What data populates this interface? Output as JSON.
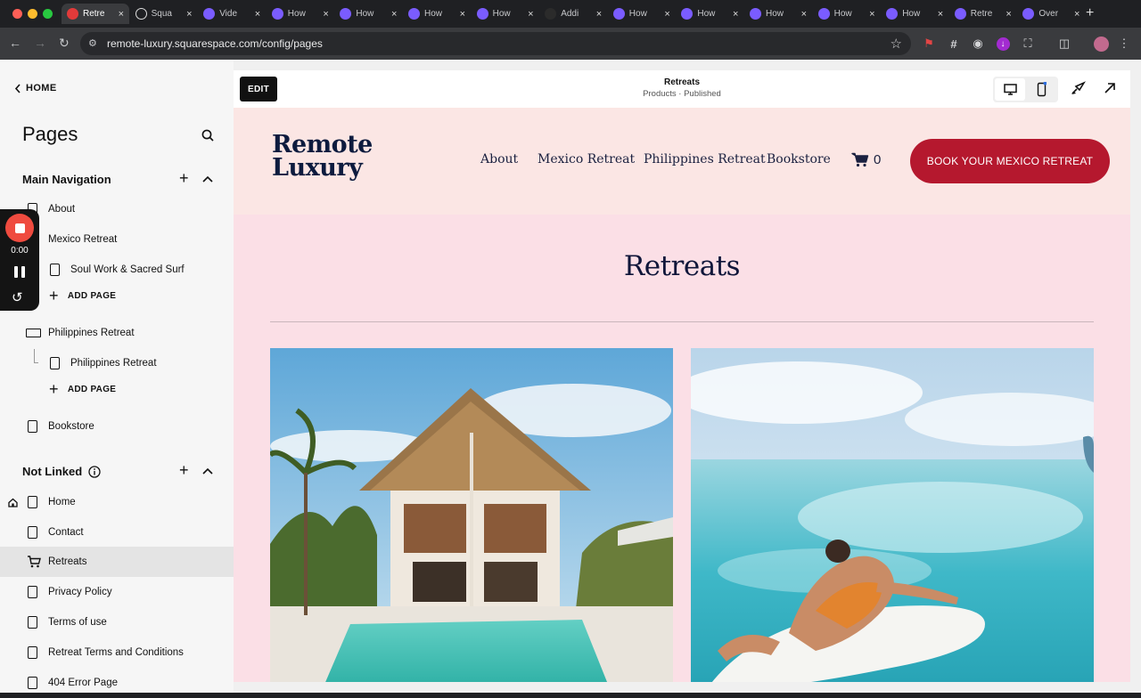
{
  "browser": {
    "tabs": [
      {
        "label": "Retre",
        "active": true,
        "favicon": "squarespace-icon"
      },
      {
        "label": "Squa",
        "favicon": "squarespace-icon"
      },
      {
        "label": "Vide",
        "favicon": "sparkle-icon"
      },
      {
        "label": "How",
        "favicon": "sparkle-icon"
      },
      {
        "label": "How",
        "favicon": "sparkle-icon"
      },
      {
        "label": "How",
        "favicon": "sparkle-icon"
      },
      {
        "label": "How",
        "favicon": "sparkle-icon"
      },
      {
        "label": "Addi",
        "favicon": "dark-icon"
      },
      {
        "label": "How",
        "favicon": "sparkle-icon"
      },
      {
        "label": "How",
        "favicon": "sparkle-icon"
      },
      {
        "label": "How",
        "favicon": "sparkle-icon"
      },
      {
        "label": "How",
        "favicon": "sparkle-icon"
      },
      {
        "label": "How",
        "favicon": "sparkle-icon"
      },
      {
        "label": "Retre",
        "favicon": "sparkle-icon"
      },
      {
        "label": "Over",
        "favicon": "sparkle-icon"
      }
    ],
    "url": "remote-luxury.squarespace.com/config/pages"
  },
  "sidebar": {
    "home_label": "HOME",
    "title": "Pages",
    "main_nav_title": "Main Navigation",
    "not_linked_title": "Not Linked",
    "add_page_label": "ADD PAGE",
    "main_nav_items": {
      "about": "About",
      "mexico": "Mexico Retreat",
      "soul": "Soul Work & Sacred Surf",
      "philippines": "Philippines Retreat",
      "philippines_child": "Philippines Retreat",
      "bookstore": "Bookstore"
    },
    "not_linked_items": {
      "home": "Home",
      "contact": "Contact",
      "retreats": "Retreats",
      "privacy": "Privacy Policy",
      "terms": "Terms of use",
      "retreat_terms": "Retreat Terms and Conditions",
      "error404": "404 Error Page"
    }
  },
  "recorder": {
    "time": "0:00"
  },
  "editor": {
    "edit_label": "EDIT",
    "page_name": "Retreats",
    "page_status": "Products · Published"
  },
  "site": {
    "logo_line1": "Remote",
    "logo_line2": "Luxury",
    "nav": {
      "about": "About",
      "mexico": "Mexico Retreat",
      "philippines": "Philippines Retreat",
      "bookstore": "Bookstore"
    },
    "cart_count": "0",
    "cta": "BOOK YOUR MEXICO RETREAT",
    "heading": "Retreats"
  },
  "colors": {
    "accent": "#b5182e",
    "site_bg": "#fbdfe6",
    "header_bg": "#fbe6e4",
    "navy": "#0d1b3e"
  }
}
